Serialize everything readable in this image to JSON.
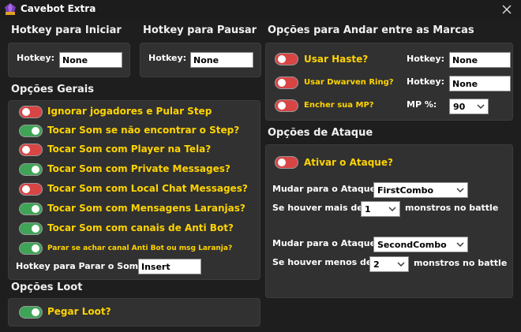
{
  "window": {
    "title": "Cavebot Extra"
  },
  "colors": {
    "accent_text": "#ffd400",
    "toggle_on": "#3fa457",
    "toggle_off": "#d84545",
    "panel": "#313131",
    "background": "#1e1e1e"
  },
  "icons": {
    "app": "gem-icon",
    "close": "close-icon",
    "dropdown": "chevron-down-icon"
  },
  "hotkey_start": {
    "section": "Hotkey para Iniciar",
    "label": "Hotkey:",
    "value": "None"
  },
  "hotkey_pause": {
    "section": "Hotkey para Pausar",
    "label": "Hotkey:",
    "value": "None"
  },
  "general": {
    "section": "Opções Gerais",
    "toggles": [
      {
        "label": "Ignorar jogadores e Pular Step",
        "on": false
      },
      {
        "label": "Tocar Som se não encontrar o Step?",
        "on": true
      },
      {
        "label": "Tocar Som com Player na Tela?",
        "on": false
      },
      {
        "label": "Tocar Som com Private Messages?",
        "on": true
      },
      {
        "label": "Tocar Som com Local Chat Messages?",
        "on": false
      },
      {
        "label": "Tocar Som com Mensagens Laranjas?",
        "on": true
      },
      {
        "label": "Tocar Som com canais de Anti Bot?",
        "on": true
      },
      {
        "label": "Parar se achar canal Anti Bot ou msg Laranja?",
        "on": true
      }
    ],
    "stop_sound": {
      "label": "Hotkey para Parar o Som:",
      "value": "Insert"
    }
  },
  "loot": {
    "section": "Opções Loot",
    "toggle": {
      "label": "Pegar Loot?",
      "on": true
    }
  },
  "walk": {
    "section": "Opções para Andar entre as Marcas",
    "rows": [
      {
        "label": "Usar Haste?",
        "on": false,
        "field_label": "Hotkey:",
        "value": "None"
      },
      {
        "label": "Usar Dwarven Ring?",
        "on": false,
        "field_label": "Hotkey:",
        "value": "None"
      },
      {
        "label": "Encher sua MP?",
        "on": false,
        "field_label": "MP %:",
        "value": "90"
      }
    ]
  },
  "attack": {
    "section": "Opções de Ataque",
    "toggle": {
      "label": "Ativar o Ataque?",
      "on": false
    },
    "rule1": {
      "change_label": "Mudar para o Ataque",
      "combo": "FirstCombo",
      "cond_label": "Se houver mais de",
      "count": "1",
      "suffix": "monstros no battle"
    },
    "rule2": {
      "change_label": "Mudar para o Ataque",
      "combo": "SecondCombo",
      "cond_label": "Se houver menos de",
      "count": "2",
      "suffix": "monstros no battle"
    }
  }
}
